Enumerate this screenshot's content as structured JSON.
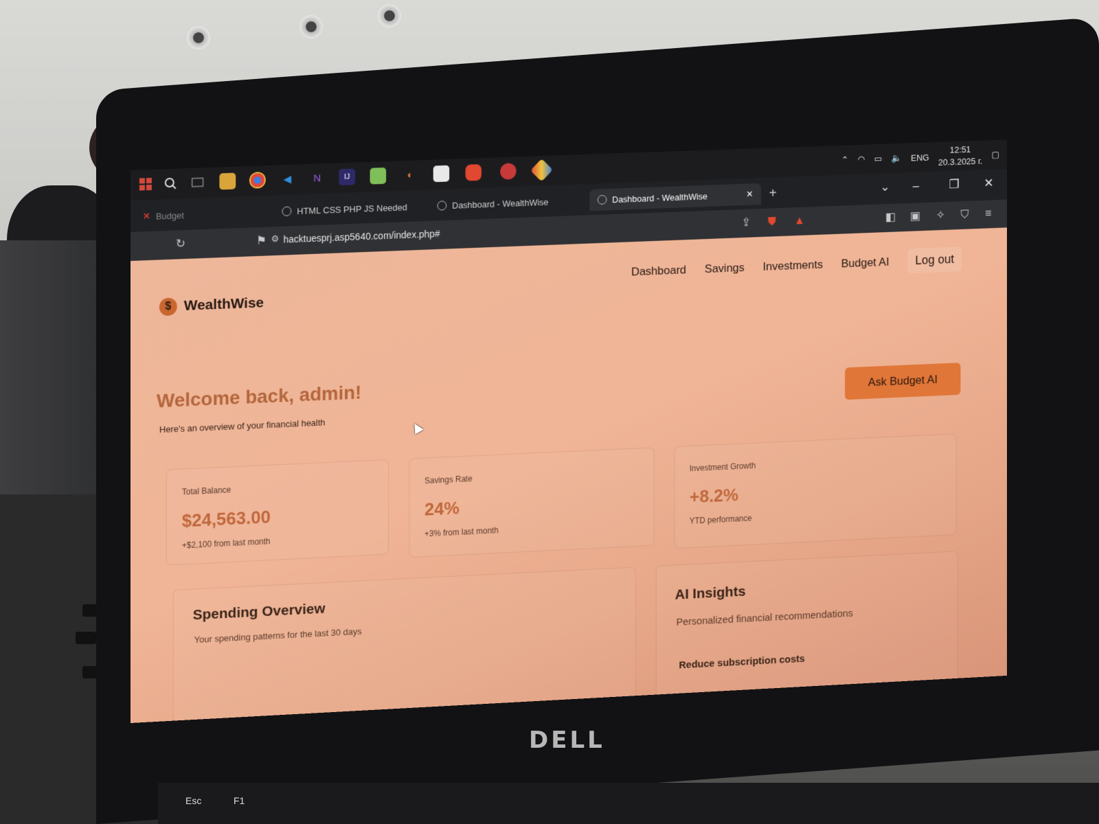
{
  "taskbar": {
    "icons": [
      "windows-start-icon",
      "search-icon",
      "task-view-icon",
      "file-explorer-icon",
      "chrome-icon",
      "vscode-icon",
      "visual-studio-icon",
      "jetbrains-icon",
      "notepad-icon",
      "app-icon",
      "paint-icon",
      "brave-icon",
      "notification-app-icon",
      "git-icon"
    ],
    "tray": {
      "language": "ENG",
      "time": "12:51",
      "date": "20.3.2025 г."
    }
  },
  "browser": {
    "tabs": [
      {
        "label": "Budget"
      },
      {
        "label": "HTML CSS PHP JS Needed"
      },
      {
        "label": "Dashboard - WealthWise"
      },
      {
        "label": "Dashboard - WealthWise",
        "active": true
      }
    ],
    "new_tab": "+",
    "url": "hacktuesprj.asp5640.com/index.php#"
  },
  "app": {
    "brand": "WealthWise",
    "brand_badge": "$",
    "nav": {
      "dashboard": "Dashboard",
      "savings": "Savings",
      "investments": "Investments",
      "budget_ai": "Budget AI",
      "logout": "Log out"
    },
    "welcome": {
      "title": "Welcome back, admin!",
      "subtitle": "Here's an overview of your financial health"
    },
    "ask_button": "Ask Budget AI",
    "cards": [
      {
        "label": "Total Balance",
        "value": "$24,563.00",
        "note": "+$2,100 from last month"
      },
      {
        "label": "Savings Rate",
        "value": "24%",
        "note": "+3% from last month"
      },
      {
        "label": "Investment Growth",
        "value": "+8.2%",
        "note": "YTD performance"
      }
    ],
    "spending": {
      "title": "Spending Overview",
      "subtitle": "Your spending patterns for the last 30 days"
    },
    "insights": {
      "title": "AI Insights",
      "subtitle": "Personalized financial recommendations",
      "first_item": "Reduce subscription costs"
    }
  },
  "hardware": {
    "brand": "DELL",
    "keys": [
      "Esc",
      "F1"
    ]
  },
  "colors": {
    "accent": "#e07638",
    "page_background": "#f0b496",
    "value_text": "#c0683c",
    "browser_dark": "#202124"
  }
}
